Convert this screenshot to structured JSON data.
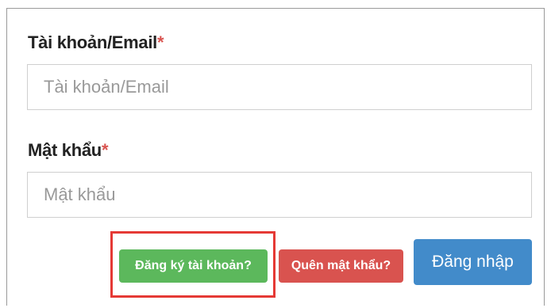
{
  "form": {
    "account_label": "Tài khoản/Email",
    "account_required_mark": "*",
    "account_placeholder": "Tài khoản/Email",
    "password_label": "Mật khẩu",
    "password_required_mark": "*",
    "password_placeholder": "Mật khẩu"
  },
  "actions": {
    "register_label": "Đăng ký tài khoản?",
    "forgot_label": "Quên mật khẩu?",
    "login_label": "Đăng nhập"
  },
  "colors": {
    "register": "#5cb85c",
    "forgot": "#d9534f",
    "login": "#428bca",
    "required_mark": "#d9534f",
    "highlight": "#e53935"
  }
}
